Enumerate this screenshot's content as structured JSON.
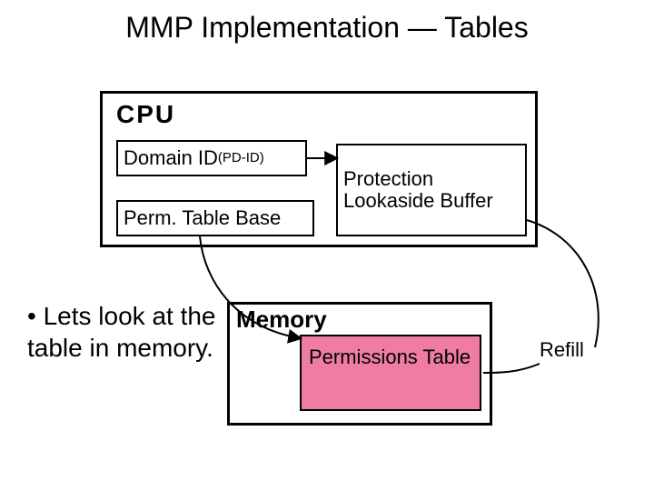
{
  "title": "MMP Implementation — Tables",
  "cpu": {
    "label": "CPU",
    "domain_id": "Domain ID",
    "pd_id": " (PD-ID)",
    "perm_table_base": "Perm. Table Base",
    "plb": "Protection Lookaside Buffer"
  },
  "memory": {
    "label": "Memory",
    "perm_table": "Permissions Table"
  },
  "refill_label": "Refill",
  "bullet": "Lets look at the table in memory."
}
